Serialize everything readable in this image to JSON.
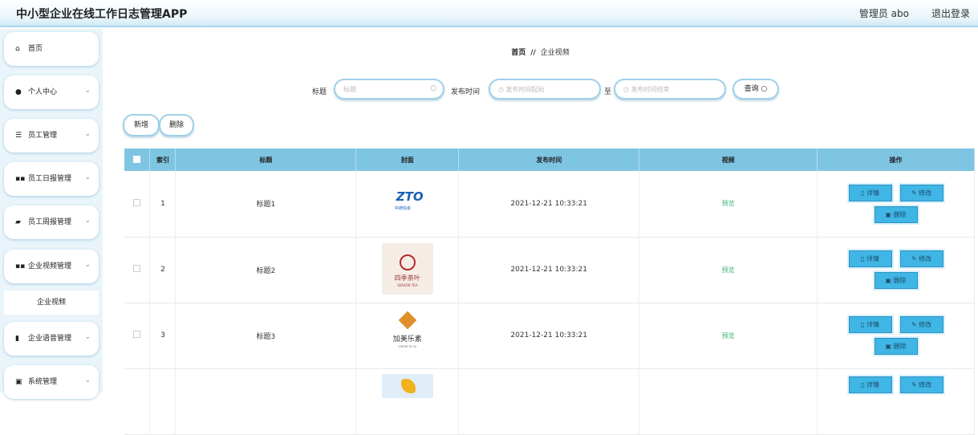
{
  "header": {
    "title": "中小型企业在线工作日志管理APP",
    "user": "管理员 abo",
    "logout": "退出登录"
  },
  "sidebar": {
    "items": [
      {
        "icon": "home-icon",
        "label": "首页"
      },
      {
        "icon": "user-icon",
        "label": "个人中心"
      },
      {
        "icon": "list-icon",
        "label": "员工管理"
      },
      {
        "icon": "grid-icon",
        "label": "员工日报管理"
      },
      {
        "icon": "thumb-icon",
        "label": "员工周报管理"
      },
      {
        "icon": "grid-icon",
        "label": "企业视频管理"
      },
      {
        "icon": "bar-chart-icon",
        "label": "企业语音管理"
      },
      {
        "icon": "clipboard-icon",
        "label": "系统管理"
      }
    ],
    "sub_item": "企业视频"
  },
  "breadcrumb": {
    "home": "首页",
    "sep": "//",
    "current": "企业视频"
  },
  "search": {
    "title_label": "标题",
    "title_placeholder": "标题",
    "time_label": "发布时间",
    "start_placeholder": "发布时间起始",
    "to_label": "至",
    "end_placeholder": "发布时间结束",
    "query_button": "查询"
  },
  "actions": {
    "add": "新增",
    "delete": "删除"
  },
  "table": {
    "columns": [
      "索引",
      "标题",
      "封面",
      "发布时间",
      "视频",
      "操作"
    ],
    "rows": [
      {
        "index": "1",
        "title": "标题1",
        "time": "2021-12-21 10:33:21",
        "video": "预览"
      },
      {
        "index": "2",
        "title": "标题2",
        "time": "2021-12-21 10:33:21",
        "video": "预览"
      },
      {
        "index": "3",
        "title": "标题3",
        "time": "2021-12-21 10:33:21",
        "video": "预览"
      }
    ],
    "ops": {
      "detail": "详情",
      "edit": "修改",
      "delete": "删除"
    }
  },
  "covers": {
    "row1": {
      "logo": "ZTO",
      "sub": "中通快递"
    },
    "row2": {
      "text": "四季茶叶",
      "sub": "SEASON TEA"
    },
    "row3": {
      "text": "加美乐素",
      "sub": "camei le su"
    }
  },
  "colors": {
    "accent": "#7ec5e2",
    "button": "#3fb6e6",
    "preview": "#3cb371"
  }
}
